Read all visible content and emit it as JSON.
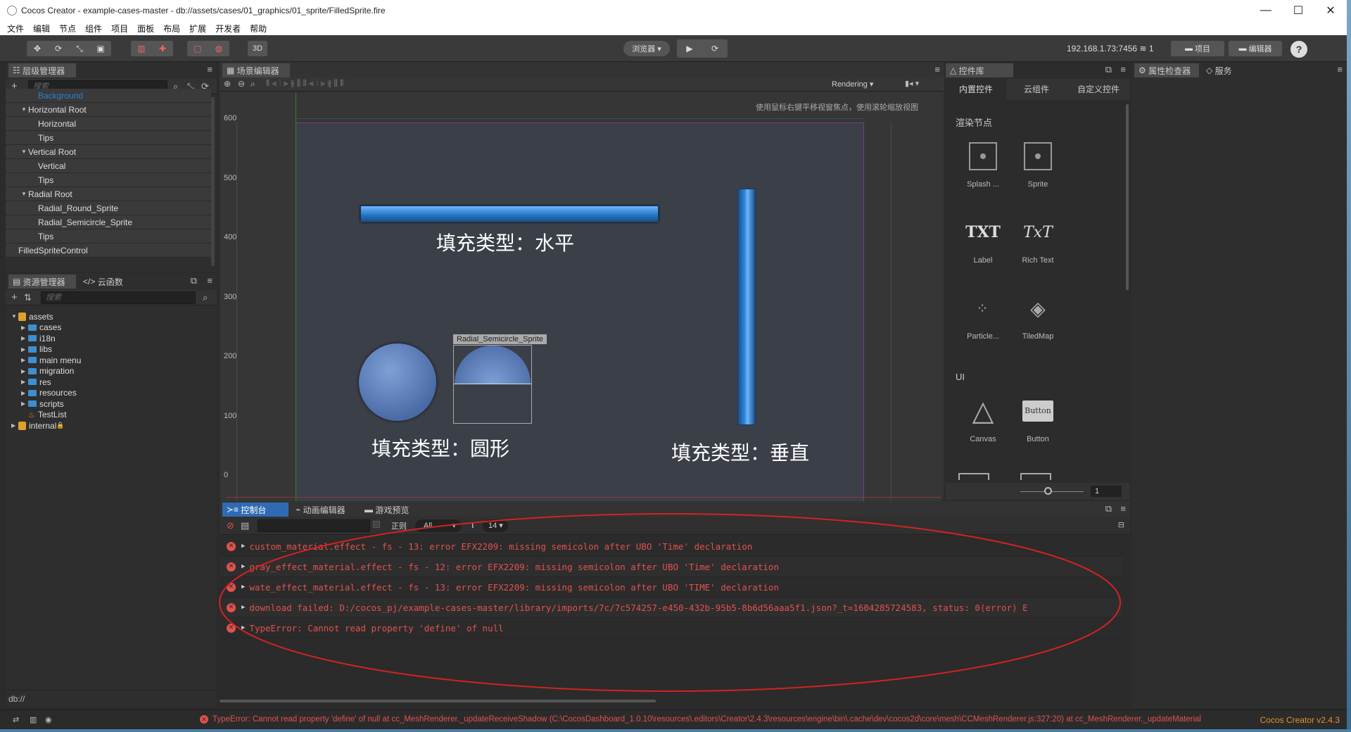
{
  "window": {
    "title": "Cocos Creator - example-cases-master - db://assets/cases/01_graphics/01_sprite/FilledSprite.fire"
  },
  "menu": [
    "文件",
    "编辑",
    "节点",
    "组件",
    "项目",
    "面板",
    "布局",
    "扩展",
    "开发者",
    "帮助"
  ],
  "toolbar": {
    "mode_3d": "3D",
    "browser": "浏览器 ▾",
    "ip": "192.168.1.73:7456",
    "count": "1",
    "project_btn": "项目",
    "editor_btn": "编辑器",
    "help": "?"
  },
  "hierarchy": {
    "tab": "层级管理器",
    "search_placeholder": "搜索",
    "nodes": [
      {
        "label": "Background",
        "depth": 2,
        "arrow": "",
        "selected": true
      },
      {
        "label": "Horizontal Root",
        "depth": 1,
        "arrow": "▼"
      },
      {
        "label": "Horizontal",
        "depth": 2,
        "arrow": ""
      },
      {
        "label": "Tips",
        "depth": 2,
        "arrow": ""
      },
      {
        "label": "Vertical Root",
        "depth": 1,
        "arrow": "▼"
      },
      {
        "label": "Vertical",
        "depth": 2,
        "arrow": ""
      },
      {
        "label": "Tips",
        "depth": 2,
        "arrow": ""
      },
      {
        "label": "Radial Root",
        "depth": 1,
        "arrow": "▼"
      },
      {
        "label": "Radial_Round_Sprite",
        "depth": 2,
        "arrow": ""
      },
      {
        "label": "Radial_Semicircle_Sprite",
        "depth": 2,
        "arrow": ""
      },
      {
        "label": "Tips",
        "depth": 2,
        "arrow": ""
      },
      {
        "label": "FilledSpriteControl",
        "depth": 0,
        "arrow": ""
      }
    ]
  },
  "assets": {
    "tab": "资源管理器",
    "tab2": "云函数",
    "search_placeholder": "搜索",
    "items": [
      {
        "label": "assets",
        "depth": 0,
        "type": "root",
        "arrow": "▼"
      },
      {
        "label": "cases",
        "depth": 1,
        "type": "folder",
        "arrow": "▶"
      },
      {
        "label": "i18n",
        "depth": 1,
        "type": "folder",
        "arrow": "▶"
      },
      {
        "label": "libs",
        "depth": 1,
        "type": "folder",
        "arrow": "▶"
      },
      {
        "label": "main menu",
        "depth": 1,
        "type": "folder",
        "arrow": "▶"
      },
      {
        "label": "migration",
        "depth": 1,
        "type": "folder",
        "arrow": "▶"
      },
      {
        "label": "res",
        "depth": 1,
        "type": "folder",
        "arrow": "▶"
      },
      {
        "label": "resources",
        "depth": 1,
        "type": "folder",
        "arrow": "▶"
      },
      {
        "label": "scripts",
        "depth": 1,
        "type": "folder",
        "arrow": "▶"
      },
      {
        "label": "TestList",
        "depth": 1,
        "type": "scene",
        "arrow": ""
      },
      {
        "label": "internal",
        "depth": 0,
        "type": "root",
        "arrow": "▶"
      }
    ],
    "path": "db://"
  },
  "scene": {
    "tab": "场景编辑器",
    "rendering": "Rendering",
    "hint": "使用鼠标右键平移视窗焦点，使用滚轮缩放视图",
    "y_ticks": [
      "600",
      "500",
      "400",
      "300",
      "200",
      "100",
      "0"
    ],
    "x_ticks": [
      "-100",
      "0",
      "100",
      "200",
      "300",
      "400",
      "500",
      "600",
      "700",
      "800",
      "900",
      "1,000"
    ],
    "label_horizontal": "填充类型：水平",
    "label_radial": "填充类型：圆形",
    "label_vertical": "填充类型：垂直",
    "selected_node": "Radial_Semicircle_Sprite"
  },
  "library": {
    "tab": "控件库",
    "tabs": [
      "内置控件",
      "云组件",
      "自定义控件"
    ],
    "section_render": "渲染节点",
    "section_ui": "UI",
    "items": [
      {
        "label": "Splash ...",
        "icon": "sprite-icon"
      },
      {
        "label": "Sprite",
        "icon": "sprite-icon"
      },
      {
        "label": "Label",
        "icon": "label-icon"
      },
      {
        "label": "Rich Text",
        "icon": "richtext-icon"
      },
      {
        "label": "Particle...",
        "icon": "particle-icon"
      },
      {
        "label": "TiledMap",
        "icon": "tiledmap-icon"
      },
      {
        "label": "Canvas",
        "icon": "canvas-icon"
      },
      {
        "label": "Button",
        "icon": "button-icon"
      }
    ],
    "label_glyph": "TXT",
    "richtext_glyph": "TxT",
    "button_glyph": "Button",
    "zoom_value": "1"
  },
  "inspector": {
    "tab": "属性检查器",
    "tab2": "服务"
  },
  "console": {
    "tab": "控制台",
    "tab2": "动画编辑器",
    "tab3": "游戏预览",
    "regex": "正则",
    "level": "All",
    "font_size": "14",
    "rows": [
      "custom_material.effect - fs - 13: error EFX2209: missing semicolon after UBO 'Time' declaration",
      "gray_effect_material.effect - fs - 12: error EFX2209: missing semicolon after UBO 'Time' declaration",
      "wate_effect_material.effect - fs - 13: error EFX2209: missing semicolon after UBO 'TIME' declaration",
      "download failed: D:/cocos_pj/example-cases-master/library/imports/7c/7c574257-e450-432b-95b5-8b6d56aaa5f1.json?_t=1604285724583, status: 0(error) E",
      "TypeError: Cannot read property 'define' of null"
    ]
  },
  "status": {
    "error": "TypeError: Cannot read property 'define' of null at cc_MeshRenderer._updateReceiveShadow (C:\\CocosDashboard_1.0.10\\resources\\.editors\\Creator\\2.4.3\\resources\\engine\\bin\\.cache\\dev\\cocos2d\\core\\mesh\\CCMeshRenderer.js:327:20) at cc_MeshRenderer._updateMaterial",
    "version": "Cocos Creator v2.4.3"
  },
  "colors": {
    "accent": "#2f7fd1",
    "error": "#e0524f",
    "annotation": "#d42222"
  }
}
